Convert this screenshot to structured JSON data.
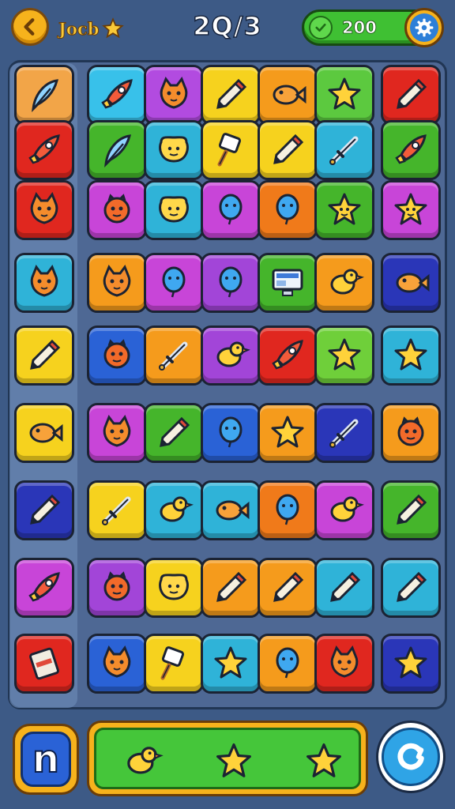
{
  "header": {
    "player_name": "Jocb",
    "level_label": "2Q/3",
    "coins": "200"
  },
  "board": {
    "tiles": [
      {
        "color": "#f2a548",
        "icon": "feather-icon"
      },
      {
        "color": "#38c1ea",
        "icon": "rocket-icon"
      },
      {
        "color": "#b24be0",
        "icon": "cat-face-icon"
      },
      {
        "color": "#f6d21e",
        "icon": "pencil-icon"
      },
      {
        "color": "#f59b1c",
        "icon": "fish-icon"
      },
      {
        "color": "#5cc93f",
        "icon": "star-icon"
      },
      {
        "color": "#e0271f",
        "icon": "pencil-icon"
      },
      {
        "color": "#e0271f",
        "icon": "rocket-icon"
      },
      {
        "color": "#45b52b",
        "icon": "feather-icon"
      },
      {
        "color": "#2fb3d8",
        "icon": "blob-icon"
      },
      {
        "color": "#f6d21e",
        "icon": "brush-icon"
      },
      {
        "color": "#f6d21e",
        "icon": "pencil-icon"
      },
      {
        "color": "#2fb3d8",
        "icon": "sword-icon"
      },
      {
        "color": "#45b52b",
        "icon": "rocket-icon"
      },
      {
        "color": "#e0271f",
        "icon": "cat-face-icon"
      },
      {
        "color": "#c845d8",
        "icon": "monster-icon"
      },
      {
        "color": "#2fb3d8",
        "icon": "blob-icon"
      },
      {
        "color": "#c845d8",
        "icon": "balloon-icon"
      },
      {
        "color": "#f07a1a",
        "icon": "balloon-icon"
      },
      {
        "color": "#45b52b",
        "icon": "star-face-icon"
      },
      {
        "color": "#c845d8",
        "icon": "star-face-icon"
      },
      {
        "color": "#2fb3d8",
        "icon": "cat-face-icon"
      },
      {
        "color": "#f59b1c",
        "icon": "cat-face-icon"
      },
      {
        "color": "#c845d8",
        "icon": "balloon-icon"
      },
      {
        "color": "#a245d8",
        "icon": "balloon-icon"
      },
      {
        "color": "#45b52b",
        "icon": "monitor-icon"
      },
      {
        "color": "#f59b1c",
        "icon": "bird-icon"
      },
      {
        "color": "#2a36b8",
        "icon": "fish-icon"
      },
      {
        "color": "#f6d21e",
        "icon": "pencil-icon"
      },
      {
        "color": "#2a62d6",
        "icon": "monster-icon"
      },
      {
        "color": "#f59b1c",
        "icon": "sword-icon"
      },
      {
        "color": "#a245d8",
        "icon": "bird-icon"
      },
      {
        "color": "#e0271f",
        "icon": "rocket-icon"
      },
      {
        "color": "#6fcf3a",
        "icon": "star-icon"
      },
      {
        "color": "#2fb3d8",
        "icon": "star-icon"
      },
      {
        "color": "#f6d21e",
        "icon": "fish-icon"
      },
      {
        "color": "#c845d8",
        "icon": "cat-face-icon"
      },
      {
        "color": "#45b52b",
        "icon": "pencil-icon"
      },
      {
        "color": "#2a62d6",
        "icon": "balloon-icon"
      },
      {
        "color": "#f59b1c",
        "icon": "star-icon"
      },
      {
        "color": "#2a36b8",
        "icon": "sword-icon"
      },
      {
        "color": "#f59b1c",
        "icon": "monster-icon"
      },
      {
        "color": "#2a36b8",
        "icon": "pencil-icon"
      },
      {
        "color": "#f6d21e",
        "icon": "sword-icon"
      },
      {
        "color": "#2fb3d8",
        "icon": "bird-icon"
      },
      {
        "color": "#2fb3d8",
        "icon": "fish-icon"
      },
      {
        "color": "#f07a1a",
        "icon": "balloon-icon"
      },
      {
        "color": "#c845d8",
        "icon": "bird-icon"
      },
      {
        "color": "#45b52b",
        "icon": "pencil-icon"
      },
      {
        "color": "#c845d8",
        "icon": "rocket-icon"
      },
      {
        "color": "#a245d8",
        "icon": "monster-icon"
      },
      {
        "color": "#f6d21e",
        "icon": "blob-icon"
      },
      {
        "color": "#f59b1c",
        "icon": "pencil-icon"
      },
      {
        "color": "#f59b1c",
        "icon": "pencil-icon"
      },
      {
        "color": "#2fb3d8",
        "icon": "pencil-icon"
      },
      {
        "color": "#2fb3d8",
        "icon": "pencil-icon"
      },
      {
        "color": "#e0271f",
        "icon": "card-icon"
      },
      {
        "color": "#2a62d6",
        "icon": "cat-face-icon"
      },
      {
        "color": "#f6d21e",
        "icon": "brush-icon"
      },
      {
        "color": "#2fb3d8",
        "icon": "star-icon"
      },
      {
        "color": "#f59b1c",
        "icon": "balloon-icon"
      },
      {
        "color": "#e0271f",
        "icon": "cat-face-icon"
      },
      {
        "color": "#2a36b8",
        "icon": "star-icon"
      }
    ]
  },
  "footer": {
    "boosters": [
      "bird-icon",
      "star-icon",
      "star-icon"
    ]
  }
}
